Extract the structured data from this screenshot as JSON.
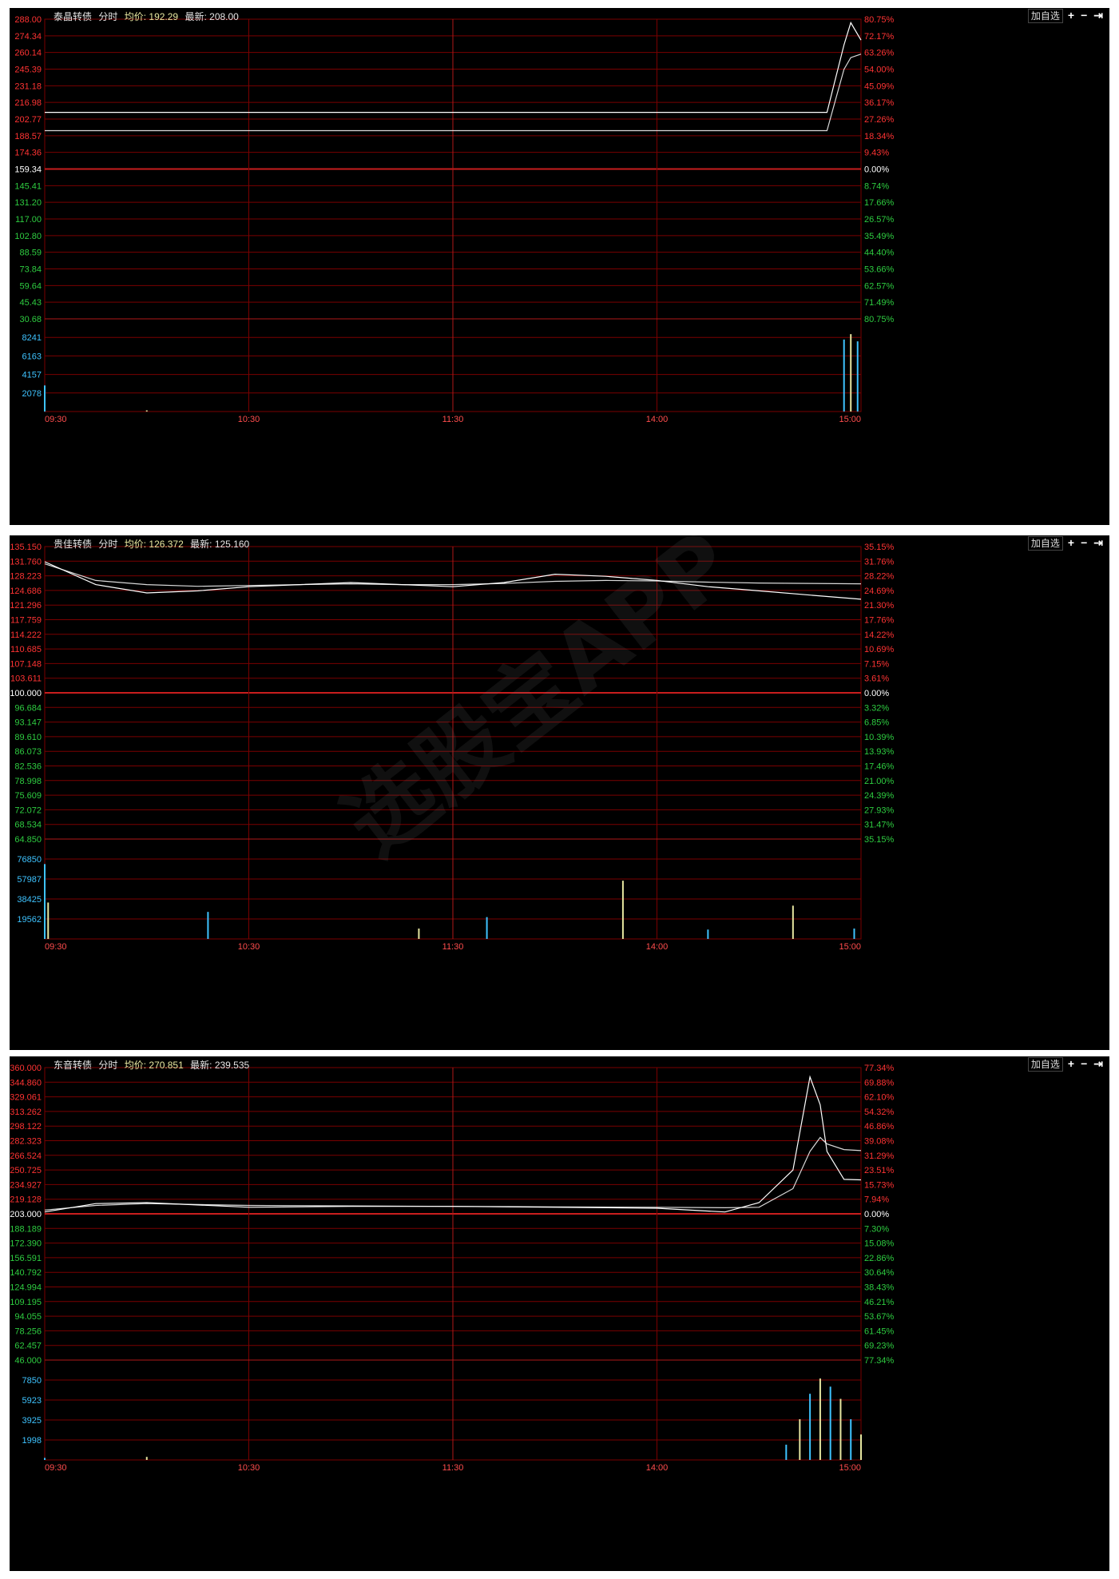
{
  "charts": [
    {
      "name": "泰晶转债",
      "mode": "分时",
      "avg_label": "均价:",
      "avg": "192.29",
      "last_label": "最新:",
      "last": "208.00",
      "price_ticks": [
        "288.00",
        "274.34",
        "260.14",
        "245.39",
        "231.18",
        "216.98",
        "202.77",
        "188.57",
        "174.36",
        "159.34",
        "145.41",
        "131.20",
        "117.00",
        "102.80",
        "88.59",
        "73.84",
        "59.64",
        "45.43",
        "30.68"
      ],
      "pct_ticks": [
        "80.75%",
        "72.17%",
        "63.26%",
        "54.00%",
        "45.09%",
        "36.17%",
        "27.26%",
        "18.34%",
        "9.43%",
        "0.00%",
        "8.74%",
        "17.66%",
        "26.57%",
        "35.49%",
        "44.40%",
        "53.66%",
        "62.57%",
        "71.49%",
        "80.75%"
      ],
      "vol_ticks": [
        "8241",
        "6163",
        "4157",
        "2078"
      ],
      "time_ticks": [
        "09:30",
        "10:30",
        "11:30",
        "14:00",
        "15:00"
      ],
      "buttons": {
        "add": "加自选",
        "plus": "+",
        "minus": "−",
        "exit": "⇥"
      }
    },
    {
      "name": "贵佳转债",
      "mode": "分时",
      "avg_label": "均价:",
      "avg": "126.372",
      "last_label": "最新:",
      "last": "125.160",
      "price_ticks": [
        "135.150",
        "131.760",
        "128.223",
        "124.686",
        "121.296",
        "117.759",
        "114.222",
        "110.685",
        "107.148",
        "103.611",
        "100.000",
        "96.684",
        "93.147",
        "89.610",
        "86.073",
        "82.536",
        "78.998",
        "75.609",
        "72.072",
        "68.534",
        "64.850"
      ],
      "pct_ticks": [
        "35.15%",
        "31.76%",
        "28.22%",
        "24.69%",
        "21.30%",
        "17.76%",
        "14.22%",
        "10.69%",
        "7.15%",
        "3.61%",
        "0.00%",
        "3.32%",
        "6.85%",
        "10.39%",
        "13.93%",
        "17.46%",
        "21.00%",
        "24.39%",
        "27.93%",
        "31.47%",
        "35.15%"
      ],
      "vol_ticks": [
        "76850",
        "57987",
        "38425",
        "19562"
      ],
      "time_ticks": [
        "09:30",
        "10:30",
        "11:30",
        "14:00",
        "15:00"
      ],
      "buttons": {
        "add": "加自选",
        "plus": "+",
        "minus": "−",
        "exit": "⇥"
      }
    },
    {
      "name": "东音转债",
      "mode": "分时",
      "avg_label": "均价:",
      "avg": "270.851",
      "last_label": "最新:",
      "last": "239.535",
      "price_ticks": [
        "360.000",
        "344.860",
        "329.061",
        "313.262",
        "298.122",
        "282.323",
        "266.524",
        "250.725",
        "234.927",
        "219.128",
        "203.000",
        "188.189",
        "172.390",
        "156.591",
        "140.792",
        "124.994",
        "109.195",
        "94.055",
        "78.256",
        "62.457",
        "46.000"
      ],
      "pct_ticks": [
        "77.34%",
        "69.88%",
        "62.10%",
        "54.32%",
        "46.86%",
        "39.08%",
        "31.29%",
        "23.51%",
        "15.73%",
        "7.94%",
        "0.00%",
        "7.30%",
        "15.08%",
        "22.86%",
        "30.64%",
        "38.43%",
        "46.21%",
        "53.67%",
        "61.45%",
        "69.23%",
        "77.34%"
      ],
      "vol_ticks": [
        "7850",
        "5923",
        "3925",
        "1998"
      ],
      "time_ticks": [
        "09:30",
        "10:30",
        "11:30",
        "14:00",
        "15:00"
      ],
      "buttons": {
        "add": "加自选",
        "plus": "+",
        "minus": "−",
        "exit": "⇥"
      }
    }
  ],
  "watermark": "选股宝APP",
  "chart_data": [
    {
      "type": "line",
      "title": "泰晶转债",
      "x": [
        "09:30",
        "10:00",
        "10:30",
        "11:00",
        "11:30",
        "13:30",
        "14:00",
        "14:30",
        "14:50",
        "14:55",
        "14:57",
        "15:00"
      ],
      "series": [
        {
          "name": "分时",
          "values": [
            208.0,
            208.0,
            208.0,
            208.0,
            208.0,
            208.0,
            208.0,
            208.0,
            208.0,
            266.0,
            285.0,
            270.0
          ]
        },
        {
          "name": "均价",
          "values": [
            192.29,
            192.29,
            192.29,
            192.29,
            192.29,
            192.29,
            192.29,
            192.29,
            192.29,
            245.0,
            255.0,
            258.0
          ]
        }
      ],
      "ylim": [
        30.68,
        288.0
      ],
      "base": 159.34,
      "volume": {
        "x": [
          "09:30",
          "10:00",
          "14:55",
          "14:57",
          "14:59"
        ],
        "values": [
          2900,
          130,
          8000,
          8600,
          7800
        ]
      },
      "vol_max": 8241,
      "colors": {
        "price": "#ffffff",
        "avg": "#ffffff",
        "grid": "#7a0000",
        "up": "#ff3333",
        "down": "#2ecc40"
      }
    },
    {
      "type": "line",
      "title": "贵佳转债",
      "x": [
        "09:30",
        "09:45",
        "10:00",
        "10:15",
        "10:30",
        "10:45",
        "11:00",
        "11:15",
        "11:30",
        "13:15",
        "13:30",
        "13:45",
        "14:00",
        "14:15",
        "14:30",
        "14:45",
        "15:00"
      ],
      "series": [
        {
          "name": "分时",
          "values": [
            131.5,
            126.0,
            124.0,
            124.5,
            125.5,
            126.0,
            126.5,
            126.0,
            125.5,
            126.5,
            128.5,
            128.0,
            127.0,
            125.5,
            124.5,
            123.5,
            122.5
          ]
        },
        {
          "name": "均价",
          "values": [
            131.0,
            127.0,
            126.0,
            125.6,
            125.8,
            126.0,
            126.2,
            126.0,
            126.0,
            126.3,
            126.8,
            127.0,
            126.9,
            126.6,
            126.4,
            126.3,
            126.2
          ]
        }
      ],
      "ylim": [
        64.85,
        135.15
      ],
      "base": 100.0,
      "volume": {
        "x": [
          "09:30",
          "09:31",
          "10:18",
          "11:20",
          "13:10",
          "13:50",
          "14:15",
          "14:40",
          "14:58"
        ],
        "values": [
          72000,
          35000,
          26000,
          10000,
          21000,
          56000,
          9000,
          32000,
          10000
        ]
      },
      "vol_max": 76850,
      "colors": {
        "price": "#ffffff",
        "avg": "#ffffff",
        "grid": "#7a0000",
        "up": "#ff3333",
        "down": "#2ecc40"
      }
    },
    {
      "type": "line",
      "title": "东音转债",
      "x": [
        "09:30",
        "09:45",
        "10:00",
        "10:30",
        "11:00",
        "11:30",
        "13:30",
        "14:00",
        "14:20",
        "14:30",
        "14:40",
        "14:45",
        "14:48",
        "14:50",
        "14:55",
        "15:00"
      ],
      "series": [
        {
          "name": "分时",
          "values": [
            205.0,
            214.0,
            215.0,
            210.0,
            211.0,
            211.0,
            210.0,
            209.0,
            205.0,
            215.0,
            250.0,
            350.0,
            320.0,
            270.0,
            240.0,
            239.5
          ]
        },
        {
          "name": "均价",
          "values": [
            207.0,
            212.0,
            214.0,
            212.0,
            211.5,
            211.0,
            210.5,
            210.0,
            209.5,
            210.0,
            230.0,
            270.0,
            285.0,
            278.0,
            272.0,
            270.85
          ]
        }
      ],
      "ylim": [
        46.0,
        360.0
      ],
      "base": 203.0,
      "volume": {
        "x": [
          "09:30",
          "10:00",
          "14:38",
          "14:42",
          "14:45",
          "14:48",
          "14:51",
          "14:54",
          "14:57",
          "15:00"
        ],
        "values": [
          200,
          300,
          1500,
          4000,
          6500,
          8000,
          7200,
          6000,
          4000,
          2500
        ]
      },
      "vol_max": 7850,
      "colors": {
        "price": "#ffffff",
        "avg": "#ffffff",
        "grid": "#7a0000",
        "up": "#ff3333",
        "down": "#2ecc40"
      }
    }
  ]
}
